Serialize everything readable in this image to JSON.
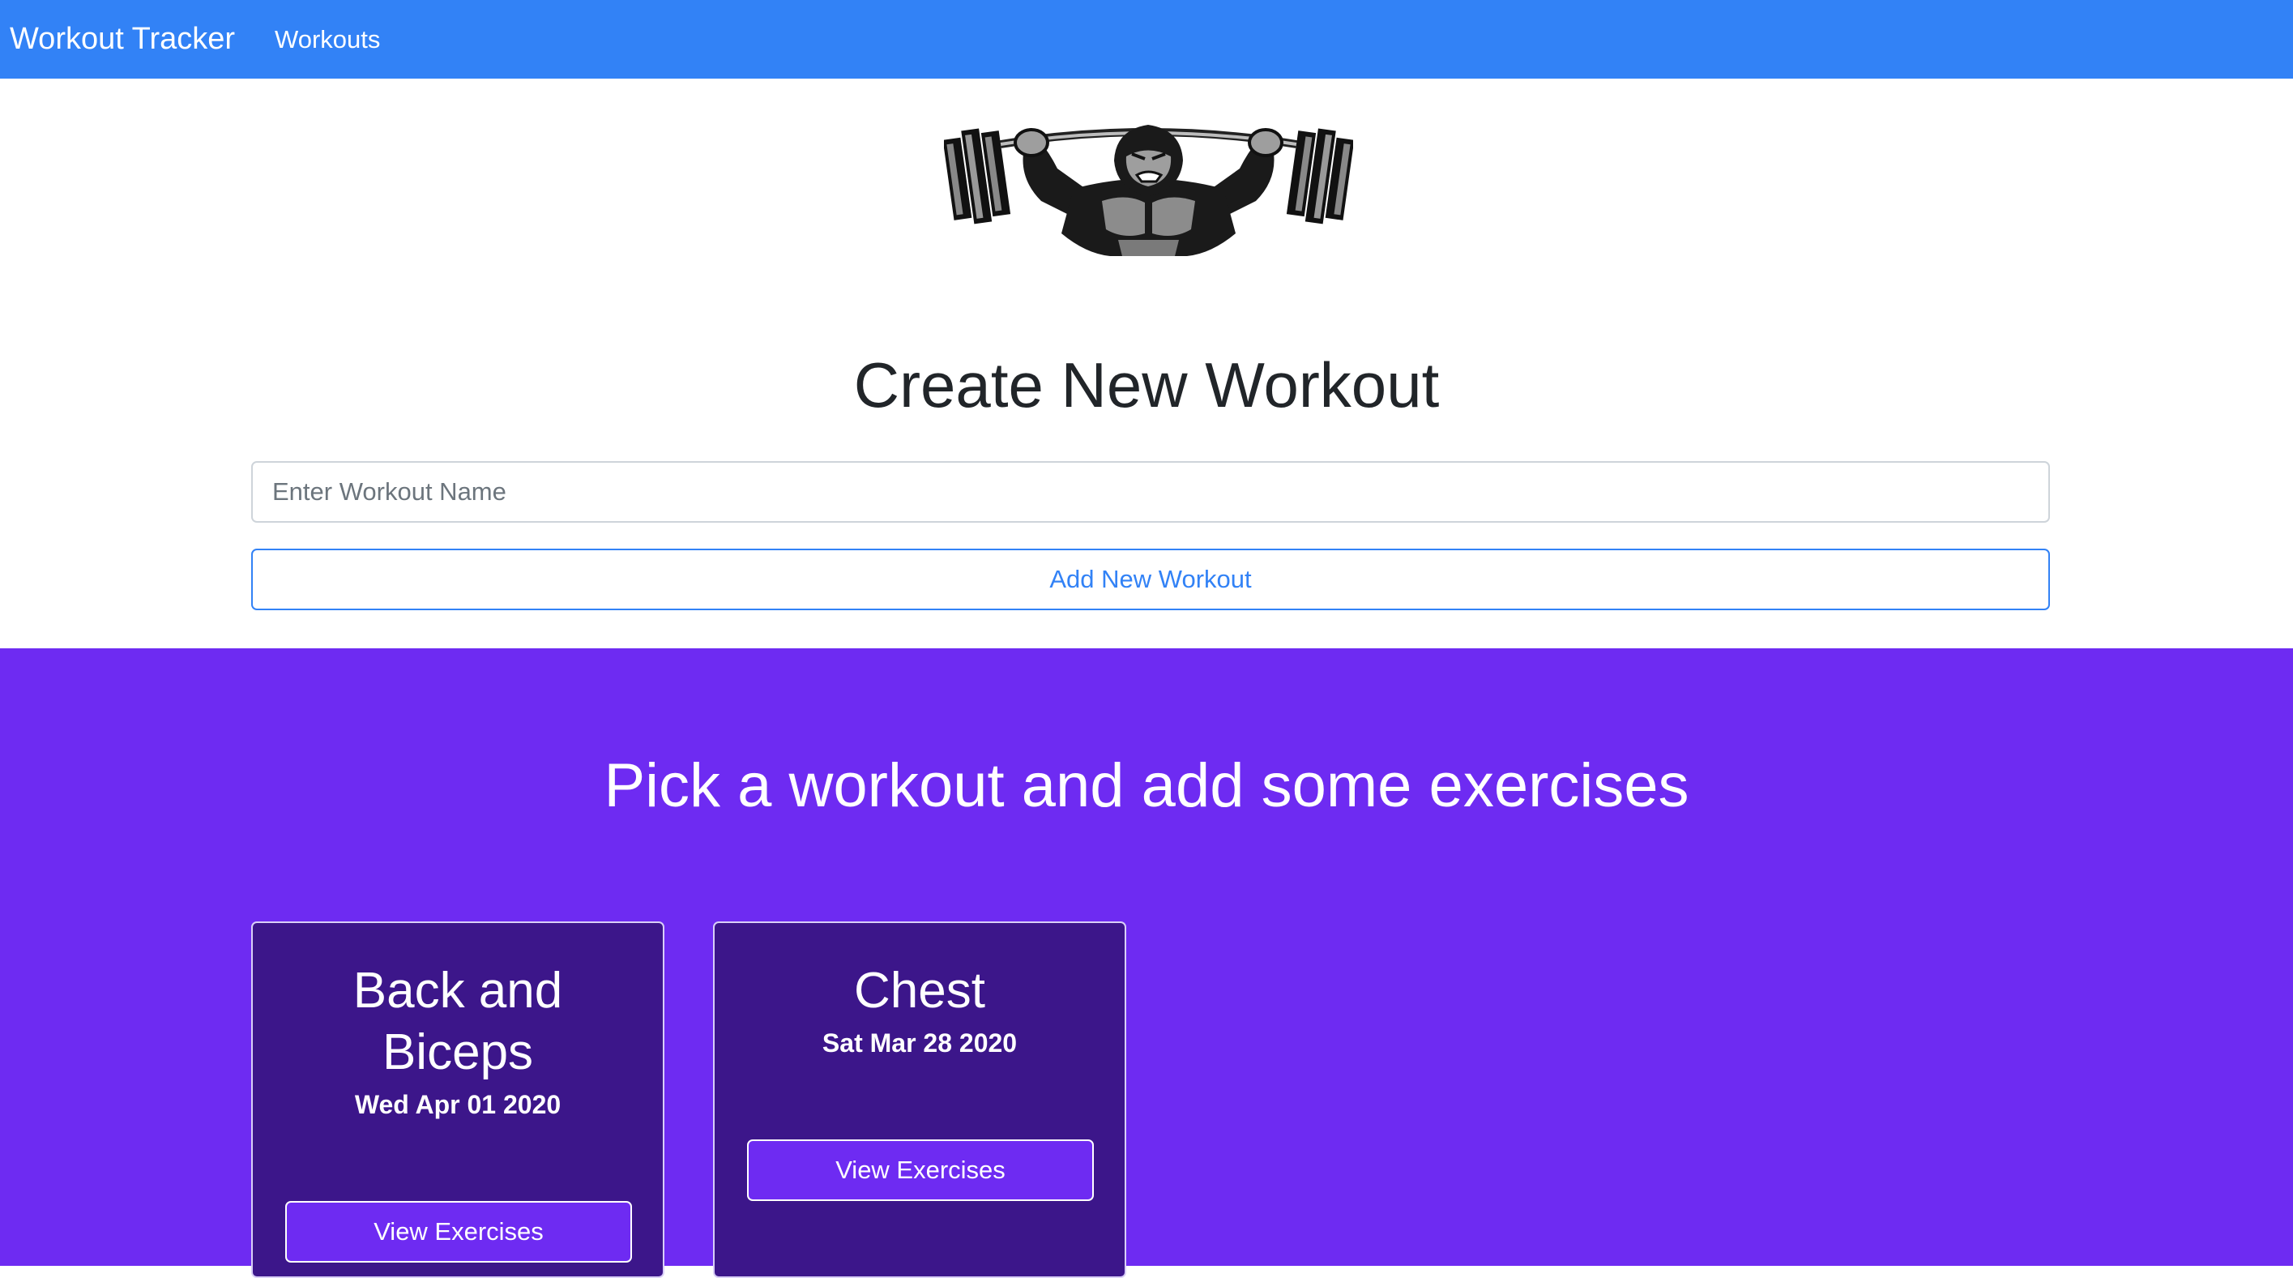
{
  "navbar": {
    "brand": "Workout Tracker",
    "links": [
      {
        "label": "Workouts"
      }
    ],
    "background_color": "#3282f6"
  },
  "logo": {
    "icon": "gorilla-barbell-logo"
  },
  "create": {
    "title": "Create New Workout",
    "input": {
      "placeholder": "Enter Workout Name",
      "value": ""
    },
    "button_label": "Add New Workout",
    "accent_color": "#3282f6"
  },
  "workouts_section": {
    "title": "Pick a workout and add some exercises",
    "background_color": "#6e2bf2",
    "cards": [
      {
        "title": "Back and Biceps",
        "date": "Wed Apr 01 2020",
        "button_label": "View Exercises"
      },
      {
        "title": "Chest",
        "date": "Sat Mar 28 2020",
        "button_label": "View Exercises"
      }
    ]
  }
}
